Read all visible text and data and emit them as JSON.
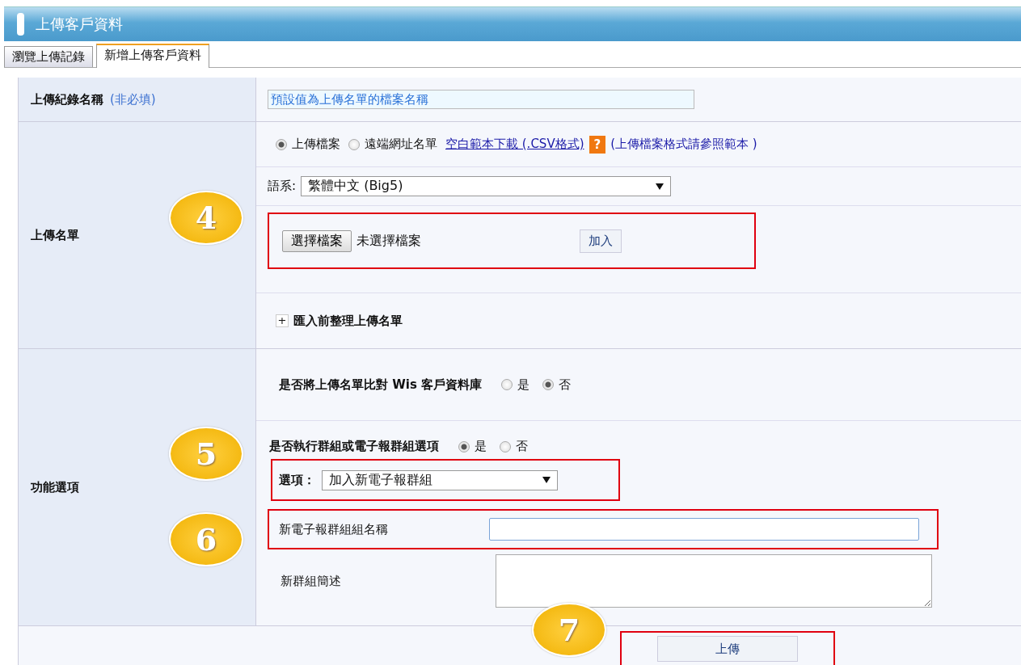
{
  "page_title": "上傳客戶資料",
  "tabs": [
    {
      "label": "瀏覽上傳記錄",
      "selected": false
    },
    {
      "label": "新增上傳客戶資料",
      "selected": true
    }
  ],
  "record_name": {
    "label": "上傳紀錄名稱",
    "note": "(非必填)",
    "value": "預設值為上傳名單的檔案名稱"
  },
  "upload_list": {
    "label": "上傳名單",
    "source_options": [
      {
        "label": "上傳檔案",
        "selected": true
      },
      {
        "label": "遠端網址名單",
        "selected": false
      }
    ],
    "template_link": "空白範本下載 (.CSV格式)",
    "help_icon": "?",
    "template_note": "(上傳檔案格式請參照範本 )",
    "language_label": "語系:",
    "language_value": "繁體中文 (Big5)",
    "choose_file_button": "選擇檔案",
    "file_status": "未選擇檔案",
    "add_button": "加入",
    "expander": {
      "icon": "+",
      "label": "匯入前整理上傳名單",
      "expanded": false
    }
  },
  "options": {
    "label": "功能選項",
    "compare": {
      "question": "是否將上傳名單比對 Wis 客戶資料庫",
      "choices": [
        {
          "label": "是",
          "selected": false
        },
        {
          "label": "否",
          "selected": true
        }
      ]
    },
    "group": {
      "question": "是否執行群組或電子報群組選項",
      "choices": [
        {
          "label": "是",
          "selected": true
        },
        {
          "label": "否",
          "selected": false
        }
      ]
    },
    "option_label": "選項：",
    "option_value": "加入新電子報群組",
    "group_name_label": "新電子報群組組名稱",
    "description_label": "新群組簡述"
  },
  "submit_button": "上傳",
  "callouts": [
    {
      "number": "4"
    },
    {
      "number": "5"
    },
    {
      "number": "6"
    },
    {
      "number": "7"
    }
  ]
}
